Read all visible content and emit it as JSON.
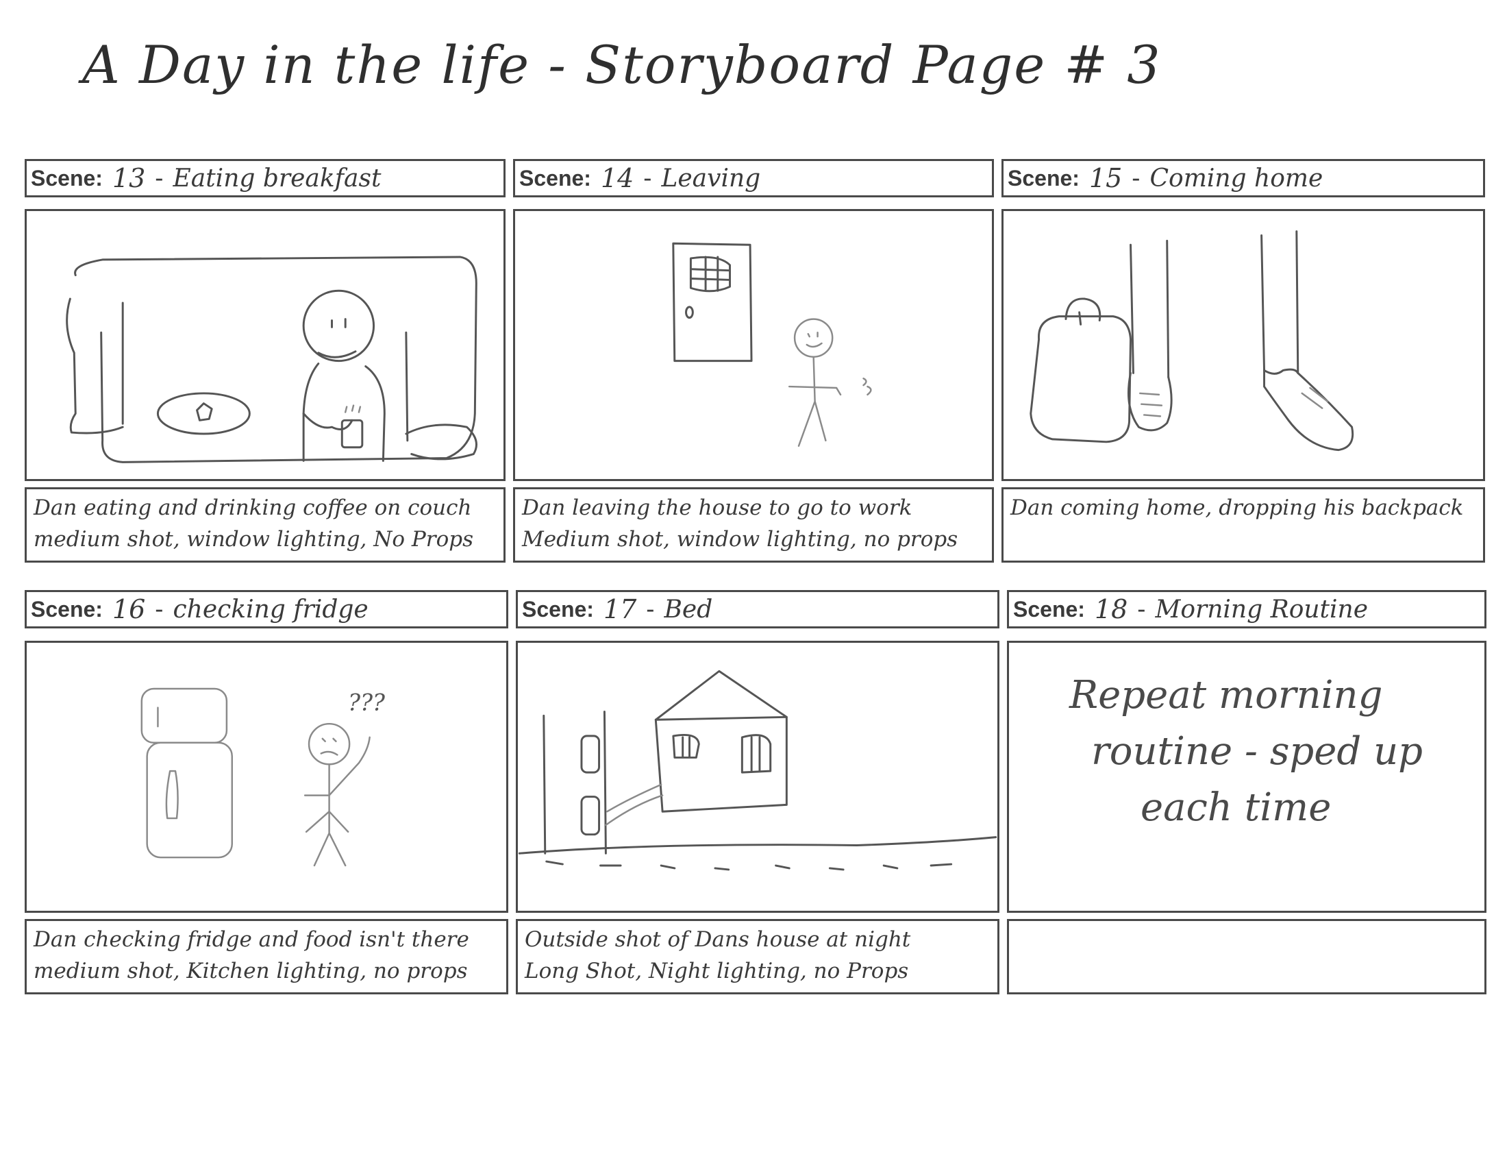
{
  "page": {
    "title": "A Day in the life - Storyboard Page # 3"
  },
  "scene_label": "Scene:",
  "panels": [
    {
      "number": "13",
      "name": "Eating breakfast",
      "caption": [
        "Dan eating and drinking coffee on couch",
        "medium shot, window lighting, No Props"
      ],
      "sketch": "couch-icon"
    },
    {
      "number": "14",
      "name": "Leaving",
      "caption": [
        "Dan leaving the house to go to work",
        "Medium shot, window lighting, no props"
      ],
      "sketch": "door-icon"
    },
    {
      "number": "15",
      "name": "Coming home",
      "caption": [
        "Dan coming home, dropping his backpack"
      ],
      "sketch": "backpack-icon"
    },
    {
      "number": "16",
      "name": "checking fridge",
      "caption": [
        "Dan checking fridge and food isn't there",
        "medium shot, Kitchen lighting, no props"
      ],
      "sketch": "fridge-icon",
      "sketch_text": "???"
    },
    {
      "number": "17",
      "name": "Bed",
      "caption": [
        "Outside shot of Dans house at night",
        "Long Shot, Night lighting, no Props"
      ],
      "sketch": "house-icon"
    },
    {
      "number": "18",
      "name": "Morning Routine",
      "caption": [],
      "sketch": "text-note",
      "note": [
        "Repeat morning",
        "routine - sped up",
        "each time"
      ]
    }
  ]
}
